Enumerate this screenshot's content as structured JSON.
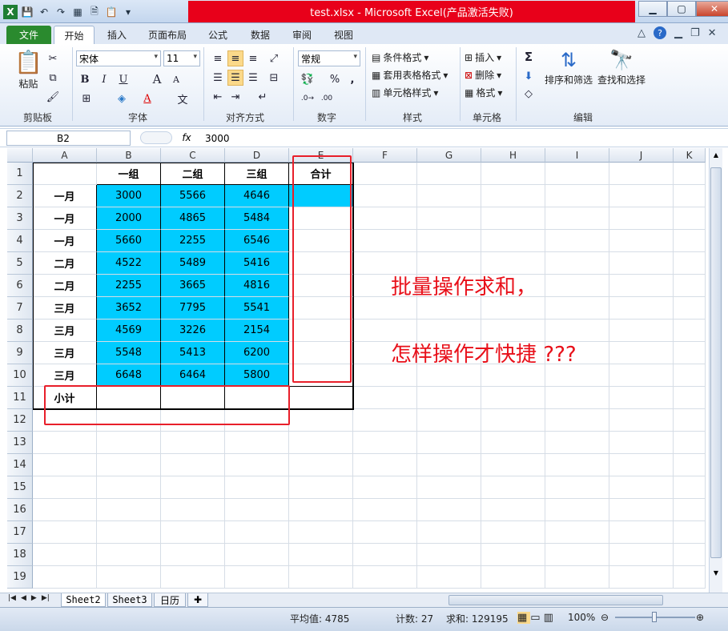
{
  "window": {
    "title": "test.xlsx  -  Microsoft Excel(产品激活失败)",
    "app_icon": "excel-icon",
    "controls": [
      "minimize-icon",
      "maximize-icon",
      "close-icon"
    ]
  },
  "ribbon_tabs": [
    "文件",
    "开始",
    "插入",
    "页面布局",
    "公式",
    "数据",
    "审阅",
    "视图"
  ],
  "ribbon": {
    "clipboard": {
      "paste": "粘贴",
      "group": "剪贴板"
    },
    "font": {
      "name": "宋体",
      "size": "11",
      "bold": "B",
      "italic": "I",
      "underline": "U",
      "grow": "A",
      "shrink": "A",
      "font_color": "A",
      "wen": "文",
      "group": "字体"
    },
    "alignment": {
      "group": "对齐方式"
    },
    "number": {
      "format": "常规",
      "percent": "%",
      "comma": ",",
      "inc_dec": "←.0\n.00",
      "dec_dec": ".00\n→.0",
      "group": "数字"
    },
    "styles": {
      "cond_format": "条件格式",
      "table_format": "套用表格格式",
      "cell_styles": "单元格样式",
      "group": "样式"
    },
    "cells": {
      "insert": "插入",
      "delete": "删除",
      "format": "格式",
      "group": "单元格"
    },
    "editing": {
      "sum": "Σ",
      "sort_filter": "排序和筛选",
      "find_select": "查找和选择",
      "group": "编辑"
    }
  },
  "formula_bar": {
    "name_box": "B2",
    "fx": "fx",
    "content": "3000"
  },
  "columns": [
    "A",
    "B",
    "C",
    "D",
    "E",
    "F",
    "G",
    "H",
    "I",
    "J",
    "K"
  ],
  "rows": [
    "1",
    "2",
    "3",
    "4",
    "5",
    "6",
    "7",
    "8",
    "9",
    "10",
    "11",
    "12",
    "13",
    "14",
    "15",
    "16",
    "17",
    "18",
    "19"
  ],
  "table": {
    "headers": [
      "一组",
      "二组",
      "三组",
      "合计"
    ],
    "body": [
      {
        "label": "一月",
        "values": [
          "3000",
          "5566",
          "4646"
        ]
      },
      {
        "label": "一月",
        "values": [
          "2000",
          "4865",
          "5484"
        ]
      },
      {
        "label": "一月",
        "values": [
          "5660",
          "2255",
          "6546"
        ]
      },
      {
        "label": "二月",
        "values": [
          "4522",
          "5489",
          "5416"
        ]
      },
      {
        "label": "二月",
        "values": [
          "2255",
          "3665",
          "4816"
        ]
      },
      {
        "label": "三月",
        "values": [
          "3652",
          "7795",
          "5541"
        ]
      },
      {
        "label": "三月",
        "values": [
          "4569",
          "3226",
          "2154"
        ]
      },
      {
        "label": "三月",
        "values": [
          "5548",
          "5413",
          "6200"
        ]
      },
      {
        "label": "三月",
        "values": [
          "6648",
          "6464",
          "5800"
        ]
      }
    ],
    "subtotal_label": "小计"
  },
  "annotation": {
    "line1": "批量操作求和，",
    "line2": "怎样操作才快捷 ???",
    "color": "#e8101a"
  },
  "highlight_color": "#00ccff",
  "sheets": [
    "Sheet2",
    "Sheet3",
    "日历"
  ],
  "status": {
    "average": "平均值: 4785",
    "count": "计数: 27",
    "sum": "求和: 129195",
    "zoom": "100%"
  }
}
